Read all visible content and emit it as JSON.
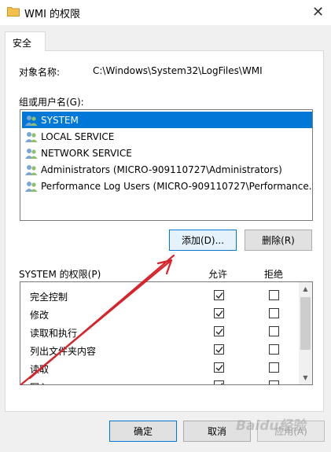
{
  "window": {
    "title": "WMI 的权限",
    "close_glyph": "✕"
  },
  "tabs": [
    {
      "label": "安全"
    }
  ],
  "object": {
    "label": "对象名称:",
    "value": "C:\\Windows\\System32\\LogFiles\\WMI"
  },
  "groups": {
    "label": "组或用户名(G):",
    "items": [
      {
        "label": "SYSTEM",
        "selected": true
      },
      {
        "label": "LOCAL SERVICE",
        "selected": false
      },
      {
        "label": "NETWORK SERVICE",
        "selected": false
      },
      {
        "label": "Administrators (MICRO-909110727\\Administrators)",
        "selected": false
      },
      {
        "label": "Performance Log Users (MICRO-909110727\\Performance...",
        "selected": false
      }
    ],
    "add_label": "添加(D)...",
    "remove_label": "删除(R)"
  },
  "permissions": {
    "label": "SYSTEM 的权限(P)",
    "allow_header": "允许",
    "deny_header": "拒绝",
    "rows": [
      {
        "name": "完全控制",
        "allow": true,
        "deny": false
      },
      {
        "name": "修改",
        "allow": true,
        "deny": false
      },
      {
        "name": "读取和执行",
        "allow": true,
        "deny": false
      },
      {
        "name": "列出文件夹内容",
        "allow": true,
        "deny": false
      },
      {
        "name": "读取",
        "allow": true,
        "deny": false
      },
      {
        "name": "写入",
        "allow": true,
        "deny": false
      }
    ]
  },
  "footer": {
    "ok_label": "确定",
    "cancel_label": "取消",
    "apply_label": "应用(A)"
  },
  "watermark": "Baidu经验",
  "colors": {
    "selection": "#0078d7",
    "arrow": "#d8232a",
    "folder": "#f2c14e"
  }
}
